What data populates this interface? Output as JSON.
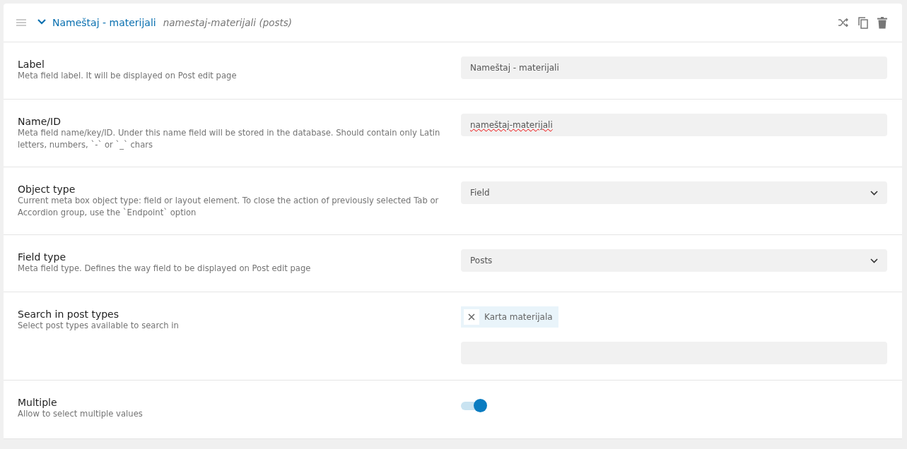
{
  "header": {
    "title": "Nameštaj - materijali",
    "subtitle": "namestaj-materijali (posts)",
    "expanded": true
  },
  "rows": [
    {
      "kind": "text",
      "label": "Label",
      "description": "Meta field label. It will be displayed on Post edit page",
      "value": "Nameštaj - materijali",
      "misspelled": false
    },
    {
      "kind": "text",
      "label": "Name/ID",
      "description": "Meta field name/key/ID. Under this name field will be stored in the database. Should contain only Latin letters, numbers, `-` or `_` chars",
      "value": "nameštaj-materijali",
      "misspelled": true
    },
    {
      "kind": "select",
      "label": "Object type",
      "description": "Current meta box object type: field or layout element. To close the action of previously selected Tab or Accordion group, use the `Endpoint` option",
      "value": "Field"
    },
    {
      "kind": "select",
      "label": "Field type",
      "description": "Meta field type. Defines the way field to be displayed on Post edit page",
      "value": "Posts"
    },
    {
      "kind": "tags",
      "label": "Search in post types",
      "description": "Select post types available to search in",
      "tags": [
        "Karta materijala"
      ]
    },
    {
      "kind": "toggle",
      "label": "Multiple",
      "description": "Allow to select multiple values",
      "on": true
    }
  ]
}
